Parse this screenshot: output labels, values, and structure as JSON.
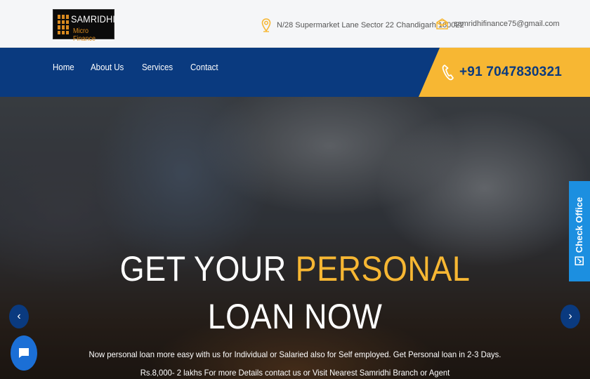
{
  "header": {
    "logo": {
      "name": "SAMRIDHI",
      "sub": "Micro Finance"
    },
    "address": "N/28 Supermarket Lane Sector 22 Chandigarh 160022",
    "email": "samridhifinance75@gmail.com"
  },
  "nav": {
    "items": [
      "Home",
      "About Us",
      "Services",
      "Contact"
    ],
    "phone": "+91 7047830321"
  },
  "hero": {
    "headline_white": "GET YOUR",
    "headline_accent": "PERSONAL",
    "headline_line2": "LOAN NOW",
    "description_1": "Now personal loan more easy with us for Individual or Salaried also for Self employed. Get Personal loan in 2-3 Days.",
    "description_2": "Rs.8,000- 2 lakhs For more Details contact us or Visit Nearest Samridhi Branch or Agent",
    "prev_arrow": "‹",
    "next_arrow": "›"
  },
  "side_tab": {
    "label": "Check Office"
  },
  "colors": {
    "navy": "#0a3a7f",
    "accent": "#f7b733",
    "tab_blue": "#1c8fe0"
  },
  "icons": [
    "location-pin-icon",
    "envelope-icon",
    "phone-icon",
    "check-square-icon",
    "chat-bubble-icon"
  ]
}
